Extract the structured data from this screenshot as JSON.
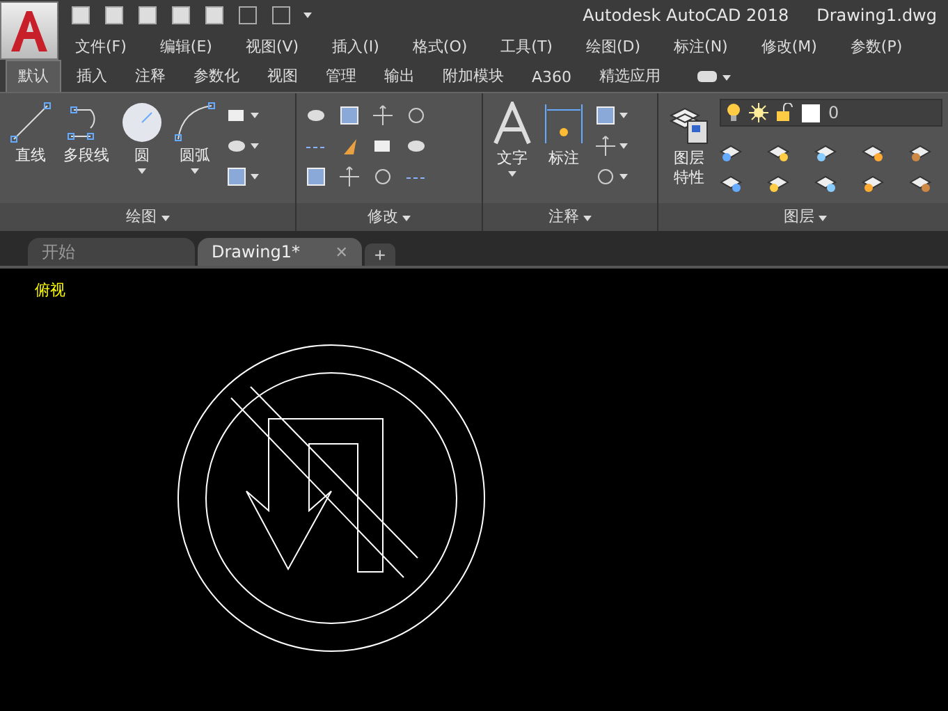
{
  "window": {
    "title": "Autodesk AutoCAD 2018",
    "document": "Drawing1.dwg"
  },
  "menu": [
    "文件(F)",
    "编辑(E)",
    "视图(V)",
    "插入(I)",
    "格式(O)",
    "工具(T)",
    "绘图(D)",
    "标注(N)",
    "修改(M)",
    "参数(P)"
  ],
  "ribbon_tabs": [
    {
      "label": "默认",
      "selected": true
    },
    {
      "label": "插入",
      "selected": false
    },
    {
      "label": "注释",
      "selected": false
    },
    {
      "label": "参数化",
      "selected": false
    },
    {
      "label": "视图",
      "selected": false
    },
    {
      "label": "管理",
      "selected": false
    },
    {
      "label": "输出",
      "selected": false
    },
    {
      "label": "附加模块",
      "selected": false
    },
    {
      "label": "A360",
      "selected": false
    },
    {
      "label": "精选应用",
      "selected": false
    }
  ],
  "panels": [
    {
      "kind": "draw",
      "title": "绘图",
      "tools": [
        {
          "kind": "line",
          "label": "直线",
          "dropdown": false
        },
        {
          "kind": "polyline",
          "label": "多段线",
          "dropdown": false
        },
        {
          "kind": "circle",
          "label": "圆",
          "dropdown": true
        },
        {
          "kind": "arc",
          "label": "圆弧",
          "dropdown": true
        }
      ]
    },
    {
      "kind": "modify",
      "title": "修改"
    },
    {
      "kind": "annotate",
      "title": "注释",
      "tools": [
        {
          "kind": "text",
          "label": "文字",
          "dropdown": true
        },
        {
          "kind": "dimension",
          "label": "标注",
          "dropdown": false
        }
      ]
    },
    {
      "kind": "layers",
      "title": "图层",
      "tools": [
        {
          "kind": "layers",
          "label": "图层特性",
          "dropdown": false
        }
      ],
      "layer": "0"
    }
  ],
  "doc_tabs": [
    {
      "label": "开始",
      "selected": false
    },
    {
      "label": "Drawing1*",
      "selected": true,
      "close": "✕"
    }
  ],
  "new_tab": "+",
  "viewport": {
    "label": "俯视"
  }
}
